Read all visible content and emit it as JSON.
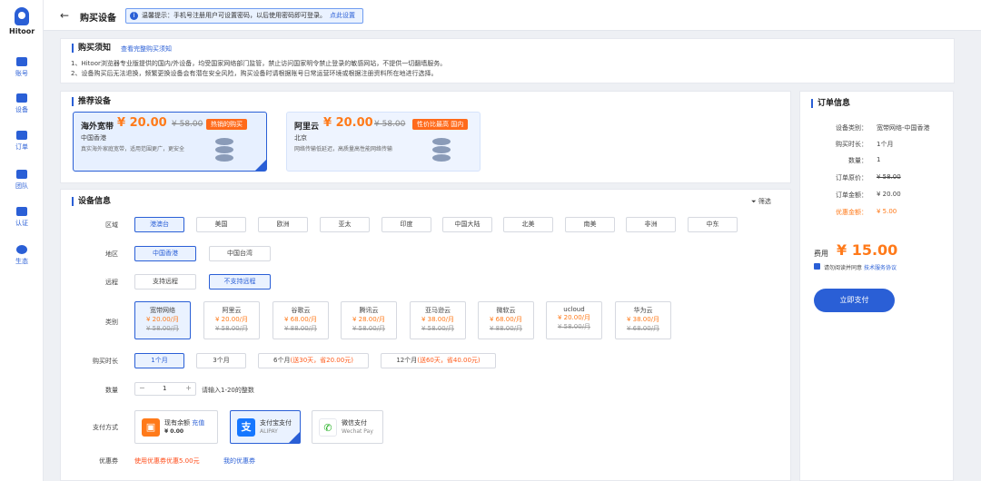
{
  "app": {
    "name": "Hitoor"
  },
  "nav": [
    {
      "label": "账号"
    },
    {
      "label": "设备"
    },
    {
      "label": "订单"
    },
    {
      "label": "团队"
    },
    {
      "label": "认证"
    },
    {
      "label": "生态"
    }
  ],
  "header": {
    "title": "购买设备",
    "tip_text": "温馨提示：手机号注册用户可设置密码，以后使用密码即可登录。",
    "tip_link": "点此设置"
  },
  "notice": {
    "title": "购买须知",
    "link": "查看完整购买须知",
    "lines": [
      "1、Hitoor浏览器专业版提供的国内/外设备，均受国家网络部门监管，禁止访问国家明令禁止登录的敏感网站，不提供一切翻墙服务。",
      "2、设备购买后无法退换，频繁更换设备会有潜在安全风险，购买设备时请根据账号日常运营环境或根据注册资料所在地进行选择。"
    ]
  },
  "recommend": {
    "title": "推荐设备",
    "items": [
      {
        "name": "海外宽带",
        "price": "¥ 20.00",
        "old": "¥ 58.00",
        "badge": "热销的购买",
        "region": "中国香港",
        "desc": "真实海外家庭宽带，适用范围更广，更安全"
      },
      {
        "name": "阿里云",
        "price": "¥ 20.00",
        "old": "¥ 58.00",
        "badge": "性价比最高 国内",
        "region": "北京",
        "desc": "网络传输低延迟，高质量高性能网络传输"
      }
    ]
  },
  "device": {
    "title": "设备信息",
    "filter": "筛选",
    "labels": {
      "zone": "区域",
      "area": "地区",
      "remote": "远程",
      "type": "类别",
      "duration": "购买时长",
      "qty": "数量",
      "pay": "支付方式",
      "coupon": "优惠券"
    },
    "zones": [
      "港澳台",
      "美国",
      "欧洲",
      "亚太",
      "印度",
      "中国大陆",
      "北美",
      "南美",
      "非洲",
      "中东"
    ],
    "areas": [
      "中国香港",
      "中国台湾"
    ],
    "remote": [
      "支持远程",
      "不支持远程"
    ],
    "types": [
      {
        "n": "宽带网络",
        "p": "¥ 20.00/月",
        "o": "¥ 58.00/月"
      },
      {
        "n": "阿里云",
        "p": "¥ 20.00/月",
        "o": "¥ 58.00/月"
      },
      {
        "n": "谷歌云",
        "p": "¥ 68.00/月",
        "o": "¥ 88.00/月"
      },
      {
        "n": "腾讯云",
        "p": "¥ 28.00/月",
        "o": "¥ 58.00/月"
      },
      {
        "n": "亚马逊云",
        "p": "¥ 38.00/月",
        "o": "¥ 58.00/月"
      },
      {
        "n": "微软云",
        "p": "¥ 68.00/月",
        "o": "¥ 88.00/月"
      },
      {
        "n": "ucloud",
        "p": "¥ 20.00/月",
        "o": "¥ 58.00/月"
      },
      {
        "n": "华为云",
        "p": "¥ 38.00/月",
        "o": "¥ 68.00/月"
      }
    ],
    "durations": [
      {
        "a": "1个月",
        "b": ""
      },
      {
        "a": "3个月",
        "b": ""
      },
      {
        "a": "6个月",
        "b": "(送30天，省20.00元)"
      },
      {
        "a": "12个月",
        "b": "(送60天，省40.00元)"
      }
    ],
    "qty": "1",
    "qty_hint": "请输入1-20的整数",
    "pays": [
      {
        "t1": "现有余额",
        "t1b": "充值",
        "t2": "¥ 0.00"
      },
      {
        "t1": "支付宝支付",
        "t2": "ALIPAY"
      },
      {
        "t1": "微信支付",
        "t2": "Wechat Pay"
      }
    ],
    "coupon_a": "使用优惠券优惠5.00元",
    "coupon_b": "我的优惠券"
  },
  "order": {
    "title": "订单信息",
    "rows": [
      {
        "k": "设备类别：",
        "v": "宽带网络-中国香港"
      },
      {
        "k": "购买时长：",
        "v": "1个月"
      },
      {
        "k": "数量：",
        "v": "1"
      },
      {
        "k": "订单原价：",
        "v": "¥ 58.00"
      },
      {
        "k": "订单金额：",
        "v": "¥ 20.00"
      },
      {
        "k": "优惠金额：",
        "v": "¥ 5.00"
      }
    ],
    "fee_label": "费用",
    "fee": "¥ 15.00",
    "agree": "请勿阅读并同意",
    "agree_link": "技术服务协议",
    "pay_btn": "立即支付"
  }
}
